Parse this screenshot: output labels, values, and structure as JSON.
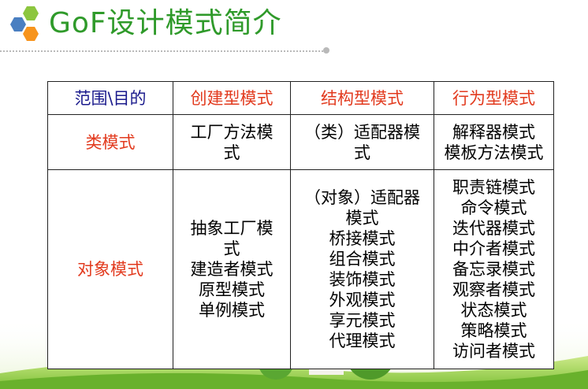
{
  "title": "GoF设计模式简介",
  "colors": {
    "title_green": "#2f9a2a",
    "header_blue": "#1a1a8c",
    "header_red": "#e23a1e",
    "logo_green": "#8cc63f",
    "logo_orange": "#f7941d",
    "logo_blue": "#4a7fc1"
  },
  "table": {
    "corner": "范围\\目的",
    "headers": [
      "创建型模式",
      "结构型模式",
      "行为型模式"
    ],
    "rows": [
      {
        "label": "类模式",
        "creational": [
          "工厂方法模",
          "式"
        ],
        "structural": [
          "（类）适配器模",
          "式"
        ],
        "behavioral": [
          "解释器模式",
          "模板方法模式"
        ]
      },
      {
        "label": "对象模式",
        "creational": [
          "抽象工厂模",
          "式",
          "建造者模式",
          "原型模式",
          "单例模式"
        ],
        "structural": [
          "（对象）适配器",
          "模式",
          "桥接模式",
          "组合模式",
          "装饰模式",
          "外观模式",
          "享元模式",
          "代理模式"
        ],
        "behavioral": [
          "职责链模式",
          "命令模式",
          "迭代器模式",
          "中介者模式",
          "备忘录模式",
          "观察者模式",
          "状态模式",
          "策略模式",
          "访问者模式"
        ]
      }
    ]
  }
}
